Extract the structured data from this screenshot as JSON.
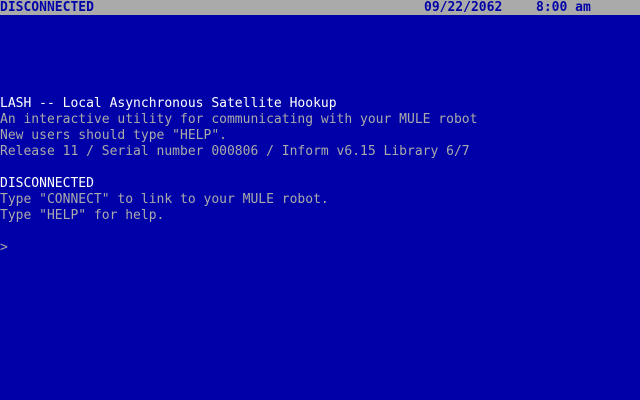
{
  "status_bar": {
    "connection": "DISCONNECTED",
    "date": "09/22/2062",
    "time": "8:00 am"
  },
  "banner": {
    "title": "LASH -- Local Asynchronous Satellite Hookup",
    "description": "An interactive utility for communicating with your MULE robot",
    "hint": "New users should type \"HELP\".",
    "release": "Release 11 / Serial number 000806 / Inform v6.15 Library 6/7"
  },
  "state": {
    "heading": "DISCONNECTED",
    "connect_hint": "Type \"CONNECT\" to link to your MULE robot.",
    "help_hint": "Type \"HELP\" for help."
  },
  "prompt": {
    "symbol": ">",
    "value": ""
  },
  "colors": {
    "background": "#0000a8",
    "text": "#aaaaaa",
    "highlight": "#ffffff",
    "status_bar": "#aaaaaa"
  }
}
